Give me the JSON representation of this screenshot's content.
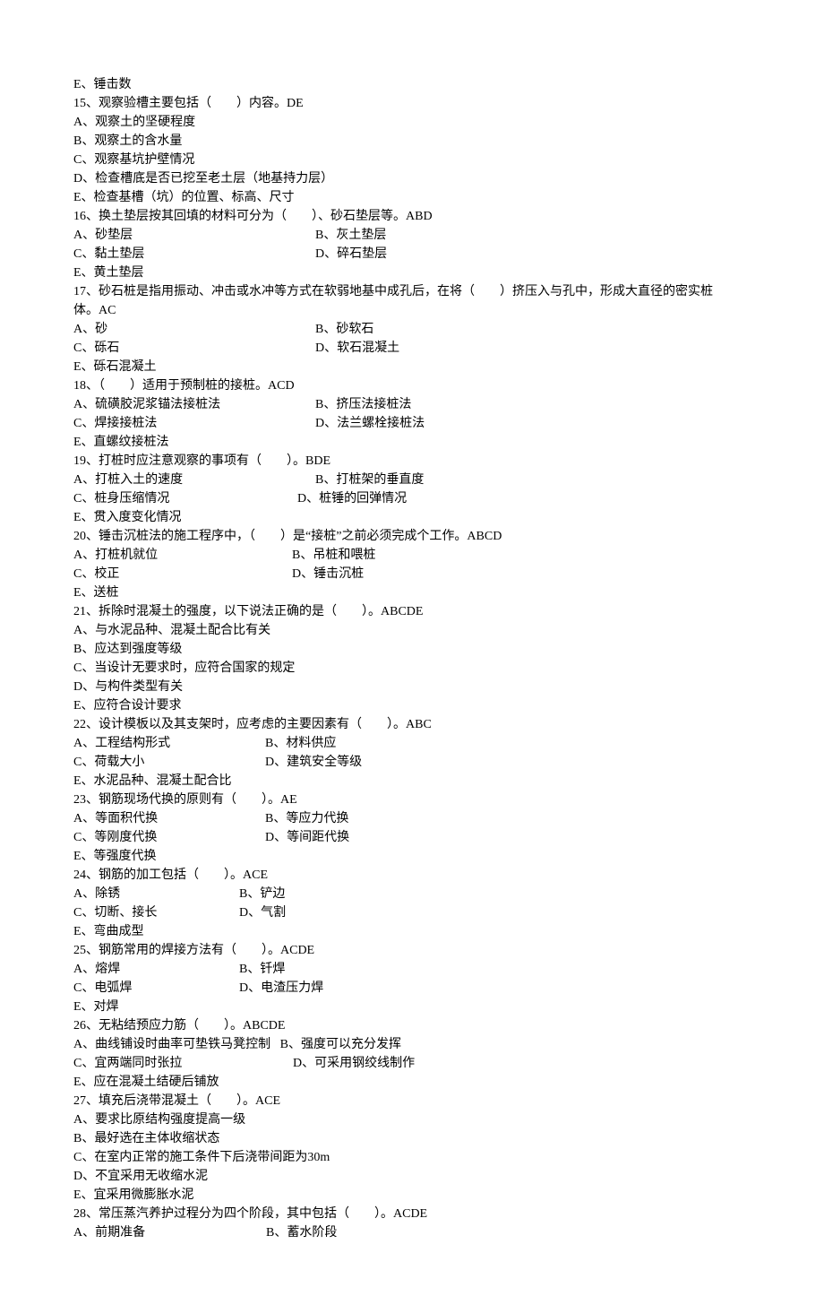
{
  "lines": [
    {
      "t": "one",
      "text": "E、锤击数"
    },
    {
      "t": "one",
      "text": "15、观察验槽主要包括（        ）内容。DE"
    },
    {
      "t": "one",
      "text": "A、观察土的坚硬程度"
    },
    {
      "t": "one",
      "text": "B、观察土的含水量"
    },
    {
      "t": "one",
      "text": "C、观察基坑护壁情况"
    },
    {
      "t": "one",
      "text": "D、检查槽底是否已挖至老土层（地基持力层）"
    },
    {
      "t": "one",
      "text": "E、检查基槽（坑）的位置、标高、尺寸"
    },
    {
      "t": "one",
      "text": "16、换土垫层按其回填的材料可分为（        ）、砂石垫层等。ABD"
    },
    {
      "t": "two",
      "left": "A、砂垫层",
      "right": "B、灰土垫层"
    },
    {
      "t": "two",
      "left": "C、黏土垫层",
      "right": "D、碎石垫层"
    },
    {
      "t": "one",
      "text": "E、黄土垫层"
    },
    {
      "t": "one",
      "text": "17、砂石桩是指用振动、冲击或水冲等方式在软弱地基中成孔后，在将（        ）挤压入与孔中，形成大直径的密实桩"
    },
    {
      "t": "one",
      "text": "体。AC"
    },
    {
      "t": "two",
      "left": "A、砂",
      "right": "B、砂软石"
    },
    {
      "t": "two",
      "left": "C、砾石",
      "right": "D、软石混凝土"
    },
    {
      "t": "one",
      "text": "E、砾石混凝土"
    },
    {
      "t": "one",
      "text": "18、（        ）适用于预制桩的接桩。ACD"
    },
    {
      "t": "two",
      "left": "A、硫磺胶泥浆锚法接桩法",
      "right": "B、挤压法接桩法"
    },
    {
      "t": "two",
      "left": "C、焊接接桩法",
      "right": "D、法兰螺栓接桩法"
    },
    {
      "t": "one",
      "text": "E、直螺纹接桩法"
    },
    {
      "t": "one",
      "text": "19、打桩时应注意观察的事项有（        ）。BDE"
    },
    {
      "t": "two",
      "left": "A、打桩入土的速度",
      "right": "B、打桩架的垂直度"
    },
    {
      "t": "two",
      "left": "C、桩身压缩情况",
      "right": "D、桩锤的回弹情况",
      "lw": 250
    },
    {
      "t": "one",
      "text": "E、贯入度变化情况"
    },
    {
      "t": "one",
      "text": "20、锤击沉桩法的施工程序中，（        ）是“接桩”之前必须完成个工作。ABCD"
    },
    {
      "t": "two",
      "left": "A、打桩机就位",
      "right": "B、吊桩和喂桩",
      "lw": 244
    },
    {
      "t": "two",
      "left": "C、校正",
      "right": "D、锤击沉桩",
      "lw": 244
    },
    {
      "t": "one",
      "text": "E、送桩"
    },
    {
      "t": "one",
      "text": "21、拆除时混凝土的强度，以下说法正确的是（        ）。ABCDE"
    },
    {
      "t": "one",
      "text": "A、与水泥品种、混凝土配合比有关"
    },
    {
      "t": "one",
      "text": "B、应达到强度等级"
    },
    {
      "t": "one",
      "text": "C、当设计无要求时，应符合国家的规定"
    },
    {
      "t": "one",
      "text": "D、与构件类型有关"
    },
    {
      "t": "one",
      "text": "E、应符合设计要求"
    },
    {
      "t": "one",
      "text": "22、设计模板以及其支架时，应考虑的主要因素有（        ）。ABC"
    },
    {
      "t": "two",
      "left": "A、工程结构形式",
      "right": "B、材料供应",
      "lw": 214
    },
    {
      "t": "two",
      "left": "C、荷载大小",
      "right": "D、建筑安全等级",
      "lw": 214
    },
    {
      "t": "one",
      "text": "E、水泥品种、混凝土配合比"
    },
    {
      "t": "one",
      "text": "23、钢筋现场代换的原则有（        ）。AE"
    },
    {
      "t": "two",
      "left": "A、等面积代换",
      "right": "B、等应力代换",
      "lw": 214
    },
    {
      "t": "two",
      "left": "C、等刚度代换",
      "right": "D、等间距代换",
      "lw": 214
    },
    {
      "t": "one",
      "text": "E、等强度代换"
    },
    {
      "t": "one",
      "text": "24、钢筋的加工包括（        ）。ACE"
    },
    {
      "t": "two",
      "left": "A、除锈",
      "right": "B、铲边",
      "lw": 185
    },
    {
      "t": "two",
      "left": "C、切断、接长",
      "right": "D、气割",
      "lw": 185
    },
    {
      "t": "one",
      "text": "E、弯曲成型"
    },
    {
      "t": "one",
      "text": "25、钢筋常用的焊接方法有（        ）。ACDE"
    },
    {
      "t": "two",
      "left": "A、熔焊",
      "right": "B、钎焊",
      "lw": 185
    },
    {
      "t": "two",
      "left": "C、电弧焊",
      "right": "D、电渣压力焊",
      "lw": 185
    },
    {
      "t": "one",
      "text": "E、对焊"
    },
    {
      "t": "one",
      "text": "26、无粘结预应力筋（        ）。ABCDE"
    },
    {
      "t": "one",
      "text": "A、曲线铺设时曲率可垫铁马凳控制   B、强度可以充分发挥"
    },
    {
      "t": "two",
      "left": "C、宜两端同时张拉",
      "right": "D、可采用钢绞线制作",
      "lw": 245
    },
    {
      "t": "one",
      "text": "E、应在混凝土结硬后铺放"
    },
    {
      "t": "one",
      "text": "27、填充后浇带混凝土（        ）。ACE"
    },
    {
      "t": "one",
      "text": "A、要求比原结构强度提高一级"
    },
    {
      "t": "one",
      "text": "B、最好选在主体收缩状态"
    },
    {
      "t": "one",
      "text": "C、在室内正常的施工条件下后浇带间距为30m"
    },
    {
      "t": "one",
      "text": "D、不宜采用无收缩水泥"
    },
    {
      "t": "one",
      "text": "E、宜采用微膨胀水泥"
    },
    {
      "t": "one",
      "text": "28、常压蒸汽养护过程分为四个阶段，其中包括（        ）。ACDE"
    },
    {
      "t": "two",
      "left": "A、前期准备",
      "right": "B、蓄水阶段",
      "lw": 215
    }
  ]
}
